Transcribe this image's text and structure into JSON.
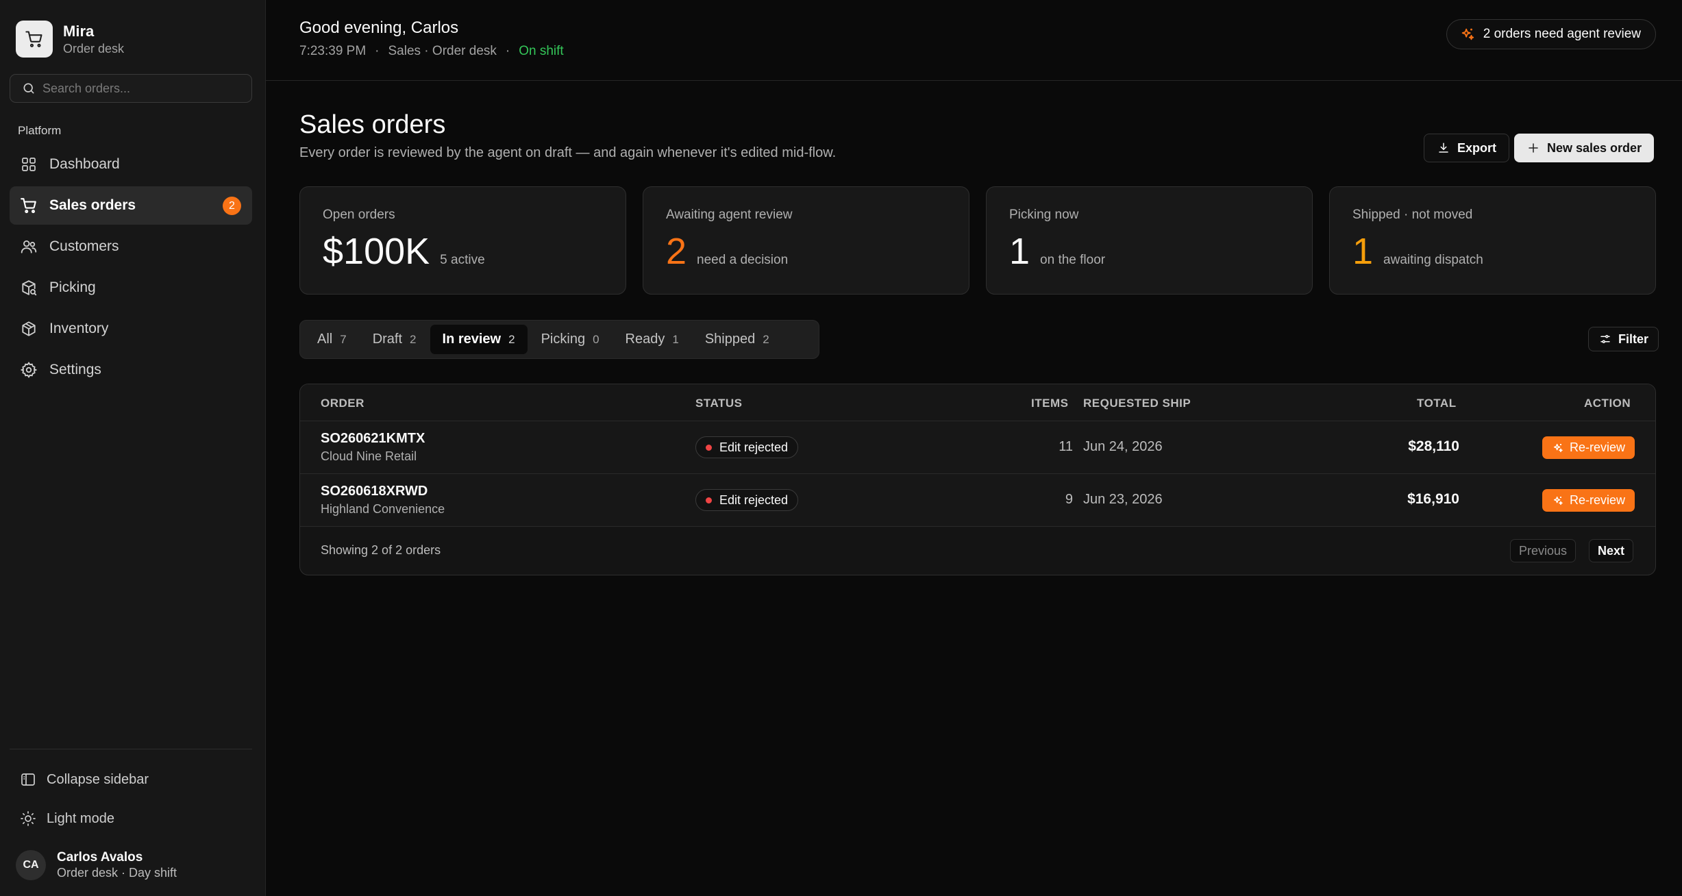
{
  "brand": {
    "name": "Mira",
    "subtitle": "Order desk",
    "icon": "cart-icon"
  },
  "search": {
    "placeholder": "Search orders..."
  },
  "sidebar": {
    "section_label": "Platform",
    "items": [
      {
        "label": "Dashboard",
        "icon": "dashboard-icon",
        "active": false
      },
      {
        "label": "Sales orders",
        "icon": "cart-icon",
        "active": true,
        "badge": "2"
      },
      {
        "label": "Customers",
        "icon": "users-icon",
        "active": false
      },
      {
        "label": "Picking",
        "icon": "picking-icon",
        "active": false
      },
      {
        "label": "Inventory",
        "icon": "box-icon",
        "active": false
      },
      {
        "label": "Settings",
        "icon": "gear-icon",
        "active": false
      }
    ],
    "collapse_label": "Collapse sidebar",
    "theme_label": "Light mode"
  },
  "user": {
    "initials": "CA",
    "name": "Carlos Avalos",
    "subtitle": "Order desk · Day shift"
  },
  "header": {
    "greeting": "Good evening, Carlos",
    "time": "7:23:39 PM",
    "context": "Sales · Order desk",
    "shift_status": "On shift",
    "review_alert": "2 orders need agent review"
  },
  "page": {
    "title": "Sales orders",
    "subtitle": "Every order is reviewed by the agent on draft — and again whenever it's edited mid-flow.",
    "export_label": "Export",
    "new_label": "New sales order"
  },
  "stats": [
    {
      "label": "Open orders",
      "value": "$100K",
      "note": "5 active",
      "color": "#fafafa"
    },
    {
      "label": "Awaiting agent review",
      "value": "2",
      "note": "need a decision",
      "color": "#f97316"
    },
    {
      "label": "Picking now",
      "value": "1",
      "note": "on the floor",
      "color": "#fafafa"
    },
    {
      "label": "Shipped · not moved",
      "value": "1",
      "note": "awaiting dispatch",
      "color": "#f59e0b"
    }
  ],
  "tabs": [
    {
      "label": "All",
      "count": "7",
      "active": false
    },
    {
      "label": "Draft",
      "count": "2",
      "active": false
    },
    {
      "label": "In review",
      "count": "2",
      "active": true
    },
    {
      "label": "Picking",
      "count": "0",
      "active": false
    },
    {
      "label": "Ready",
      "count": "1",
      "active": false
    },
    {
      "label": "Shipped",
      "count": "2",
      "active": false
    }
  ],
  "filter_label": "Filter",
  "table": {
    "columns": {
      "order": "ORDER",
      "status": "STATUS",
      "items": "ITEMS",
      "ship": "REQUESTED SHIP",
      "total": "TOTAL",
      "action": "ACTION"
    },
    "rows": [
      {
        "order_id": "SO260621KMTX",
        "customer": "Cloud Nine Retail",
        "status": "Edit rejected",
        "items": "11",
        "ship": "Jun 24, 2026",
        "total": "$28,110",
        "action": "Re-review"
      },
      {
        "order_id": "SO260618XRWD",
        "customer": "Highland Convenience",
        "status": "Edit rejected",
        "items": "9",
        "ship": "Jun 23, 2026",
        "total": "$16,910",
        "action": "Re-review"
      }
    ],
    "showing": "Showing 2 of 2 orders",
    "prev_label": "Previous",
    "next_label": "Next"
  },
  "colors": {
    "accent": "#f97316",
    "success": "#34c759",
    "danger": "#ef4444",
    "amber": "#f59e0b"
  }
}
